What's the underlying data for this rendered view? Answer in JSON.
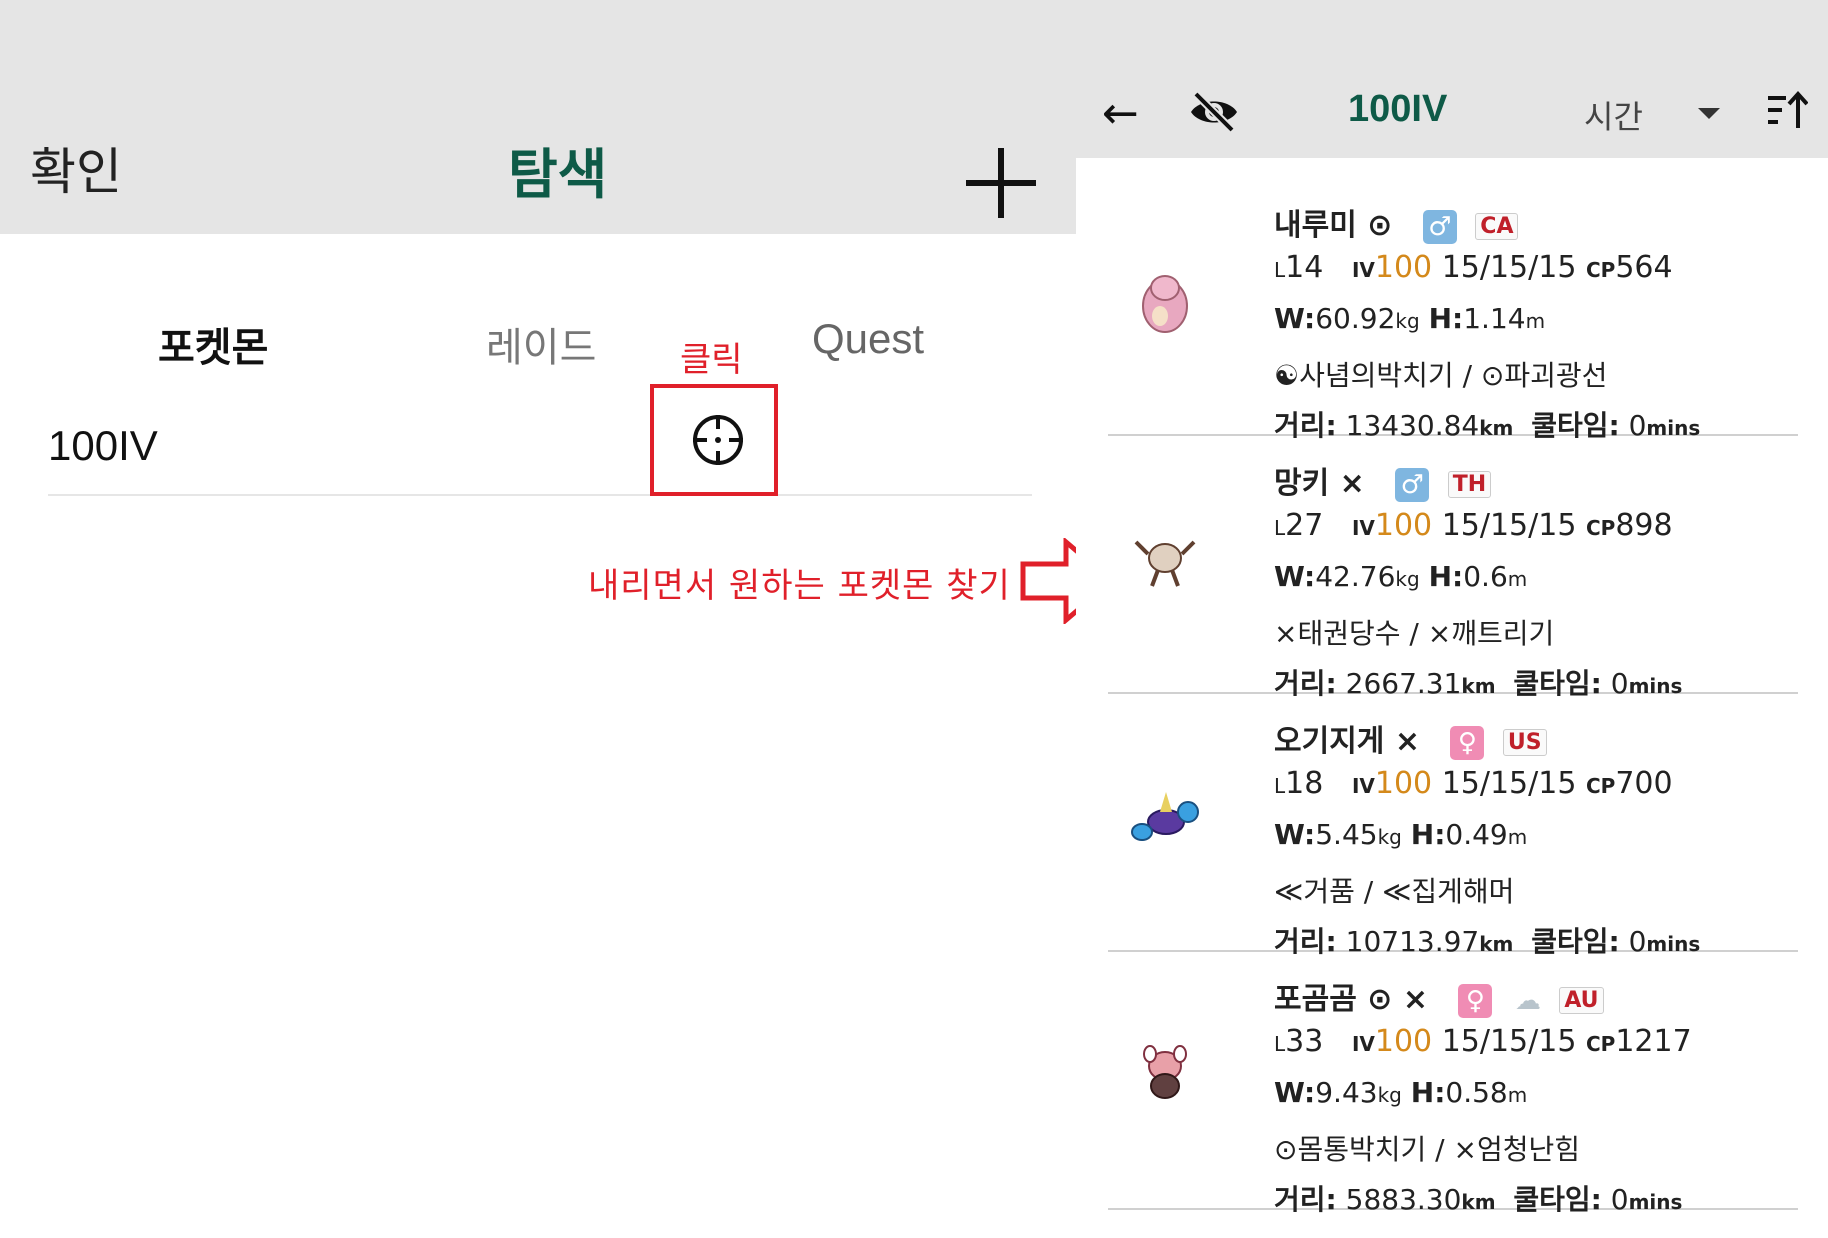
{
  "left": {
    "confirm_label": "확인",
    "title": "탐색",
    "tabs": [
      "포켓몬",
      "레이드",
      "Quest"
    ],
    "annotation_click": "클릭",
    "row_label": "100IV",
    "annotation_scroll": "내리면서 원하는 포켓몬 찾기",
    "accent_color": "#0e5a47",
    "annotation_color": "#e0202a"
  },
  "right": {
    "title": "100IV",
    "sort_label": "시간",
    "icons": [
      "back-arrow-icon",
      "eye-off-icon",
      "dropdown-icon",
      "sort-icon"
    ],
    "labels": {
      "distance": "거리:",
      "cooltime": "쿨타임:",
      "w": "W:",
      "h": "H:",
      "l": "L",
      "iv": "IV",
      "cp": "CP",
      "kg": "kg",
      "m": "m",
      "km": "km",
      "mins": "mins"
    },
    "cards": [
      {
        "name": "내루미 ⊙",
        "gender": "♂",
        "flag": "CA",
        "weather": "",
        "level": "14",
        "iv": "100",
        "ivs": "15/15/15",
        "cp": "564",
        "weight": "60.92",
        "height": "1.14",
        "moves": "☯사념의박치기 / ⊙파괴광선",
        "distance": "13430.84",
        "cooltime": "0",
        "sprite_color": "#e8a8c0"
      },
      {
        "name": "망키 ⨯",
        "gender": "♂",
        "flag": "TH",
        "weather": "",
        "level": "27",
        "iv": "100",
        "ivs": "15/15/15",
        "cp": "898",
        "weight": "42.76",
        "height": "0.6",
        "moves": "⨯태권당수 / ⨯깨트리기",
        "distance": "2667.31",
        "cooltime": "0",
        "sprite_color": "#d8c8b8"
      },
      {
        "name": "오기지게 ⨯",
        "gender": "♀",
        "flag": "US",
        "weather": "",
        "level": "18",
        "iv": "100",
        "ivs": "15/15/15",
        "cp": "700",
        "weight": "5.45",
        "height": "0.49",
        "moves": "≪거품 / ≪집게해머",
        "distance": "10713.97",
        "cooltime": "0",
        "sprite_color": "#5a3aa0"
      },
      {
        "name": "포곰곰 ⊙ ⨯",
        "gender": "♀",
        "flag": "AU",
        "weather": "☁",
        "level": "33",
        "iv": "100",
        "ivs": "15/15/15",
        "cp": "1217",
        "weight": "9.43",
        "height": "0.58",
        "moves": "⊙몸통박치기 / ⨯엄청난힘",
        "distance": "5883.30",
        "cooltime": "0",
        "sprite_color": "#e8a0a8"
      }
    ]
  }
}
